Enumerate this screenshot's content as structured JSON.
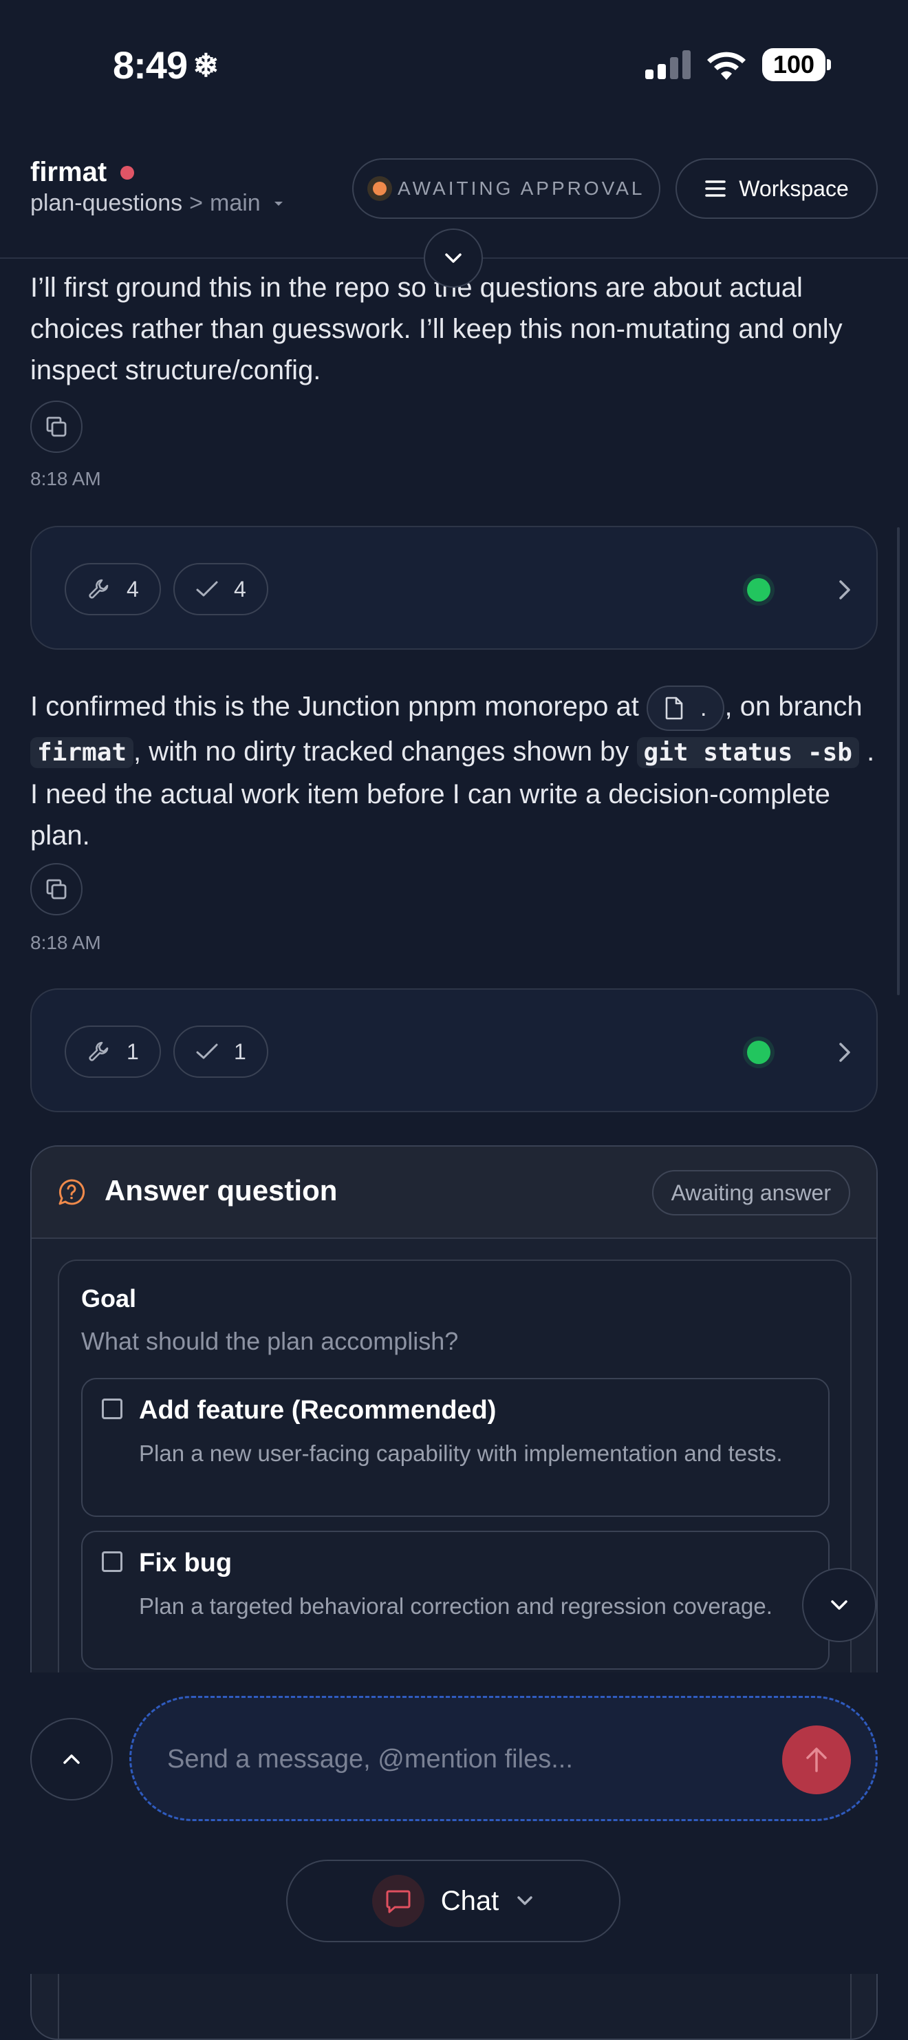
{
  "status_bar": {
    "time": "8:49",
    "battery": "100"
  },
  "header": {
    "project": "firmat",
    "branch": "plan-questions",
    "branch_sep": ">",
    "base": "main",
    "status_pill": "AWAITING APPROVAL",
    "workspace_label": "Workspace"
  },
  "messages": [
    {
      "text": "I’ll first ground this in the repo so the questions are about actual choices rather than guesswork. I’ll keep this non-mutating and only inspect structure/config.",
      "time": "8:18 AM"
    },
    {
      "part1": "I confirmed this is the Junction pnpm monorepo at",
      "file_chip": ".",
      "part2": ", on branch",
      "code1": "firmat",
      "part3": ", with no dirty tracked changes shown by",
      "code2": "git status -sb",
      "part4": ". I need the actual work item before I can write a decision-complete plan.",
      "time": "8:18 AM"
    }
  ],
  "tool_cards": [
    {
      "tools": "4",
      "checks": "4"
    },
    {
      "tools": "1",
      "checks": "1"
    }
  ],
  "question": {
    "title": "Answer question",
    "badge": "Awaiting answer",
    "goal_title": "Goal",
    "goal_prompt": "What should the plan accomplish?",
    "options": [
      {
        "title": "Add feature (Recommended)",
        "desc": "Plan a new user-facing capability with implementation and tests."
      },
      {
        "title": "Fix bug",
        "desc": "Plan a targeted behavioral correction and regression coverage."
      }
    ]
  },
  "composer": {
    "placeholder": "Send a message, @mention files..."
  },
  "mode": {
    "label": "Chat"
  },
  "colors": {
    "accent_red": "#b53646",
    "status_green": "#22c55e",
    "status_orange": "#f08a4b",
    "background": "#141b2c"
  }
}
